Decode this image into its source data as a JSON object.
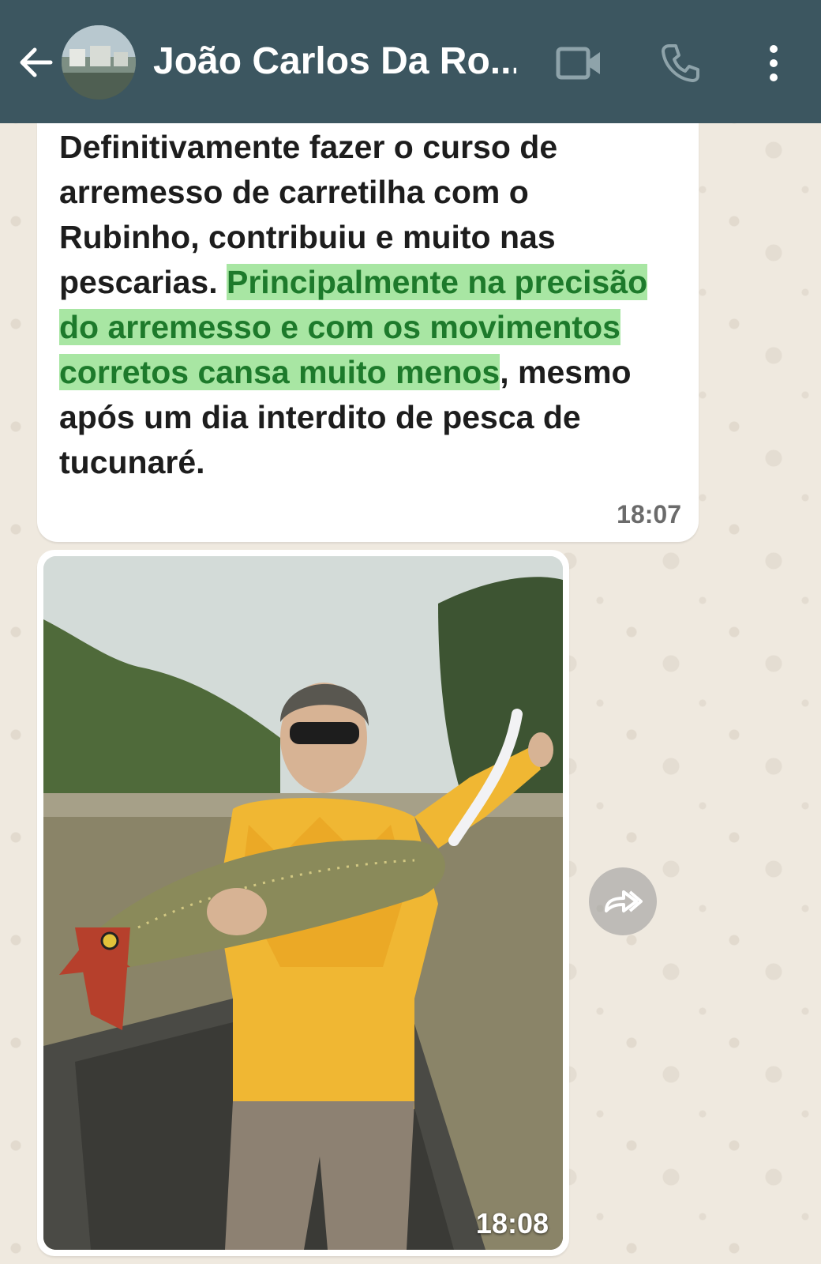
{
  "header": {
    "contact_name": "João Carlos Da Ro...",
    "back_icon": "arrow-left-icon",
    "video_icon": "video-camera-icon",
    "call_icon": "phone-icon",
    "menu_icon": "more-vertical-icon",
    "background_color": "#3c5660"
  },
  "messages": [
    {
      "type": "text",
      "segments": [
        {
          "text": "Definitivamente fazer o curso de arremesso de carretilha com o Rubinho, contribuiu e muito nas pescarias. ",
          "highlighted": false
        },
        {
          "text": "Principalmente na precisão do arremesso e com os movimentos corretos cansa muito menos",
          "highlighted": true
        },
        {
          "text": ", mesmo após um dia interdito de pesca de tucunaré.",
          "highlighted": false
        }
      ],
      "time": "18:07"
    },
    {
      "type": "image",
      "image_alt": "Man in yellow fishing shirt holding a peacock bass on a boat",
      "time": "18:08",
      "forward_icon": "forward-icon"
    }
  ],
  "colors": {
    "highlight_bg": "#a8e6a3",
    "highlight_text": "#1d7a2b",
    "wallpaper": "#efe9df"
  }
}
